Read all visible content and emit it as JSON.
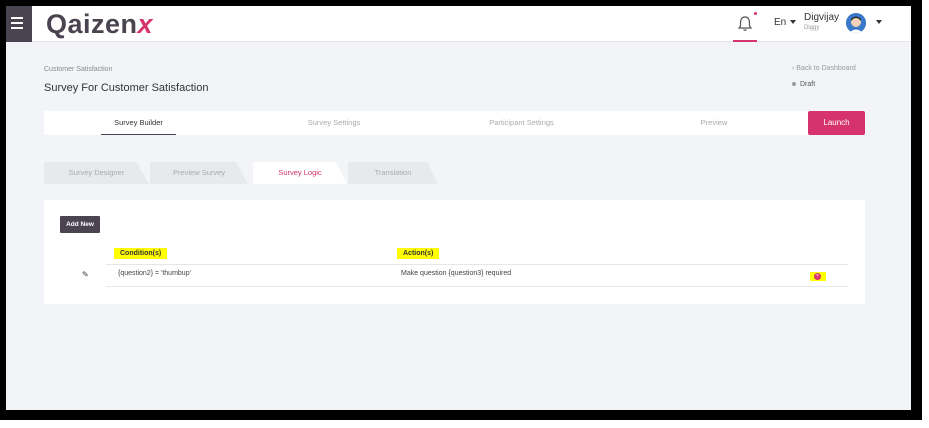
{
  "app": {
    "logo_q": "Qaizen",
    "logo_x": "x"
  },
  "header": {
    "language": "En",
    "user_name": "Digvijay",
    "user_sub": "Diggy"
  },
  "breadcrumb": "Customer Satisfaction",
  "page_title": "Survey For Customer Satisfaction",
  "back_link": "Back to Dashboard",
  "status": "Draft",
  "steps": [
    {
      "label": "Survey Builder",
      "active": true
    },
    {
      "label": "Survey Settings",
      "active": false
    },
    {
      "label": "Participant Settings",
      "active": false
    },
    {
      "label": "Preview",
      "active": false
    }
  ],
  "launch_label": "Launch",
  "tabs": [
    {
      "label": "Survey Designer",
      "active": false
    },
    {
      "label": "Preview Survey",
      "active": false
    },
    {
      "label": "Survey Logic",
      "active": true
    },
    {
      "label": "Translation",
      "active": false
    }
  ],
  "logic": {
    "add_new": "Add New",
    "columns": {
      "condition": "Condition(s)",
      "action": "Action(s)"
    },
    "rows": [
      {
        "condition": "{question2} = 'thumbup'",
        "action": "Make question {question3} required"
      }
    ]
  },
  "colors": {
    "accent": "#d6336c",
    "dark": "#4a4450",
    "highlight": "#ffff00"
  },
  "icons": {
    "menu": "hamburger-icon",
    "bell": "bell-icon",
    "edit": "pin-icon",
    "delete": "close-circle-icon"
  }
}
